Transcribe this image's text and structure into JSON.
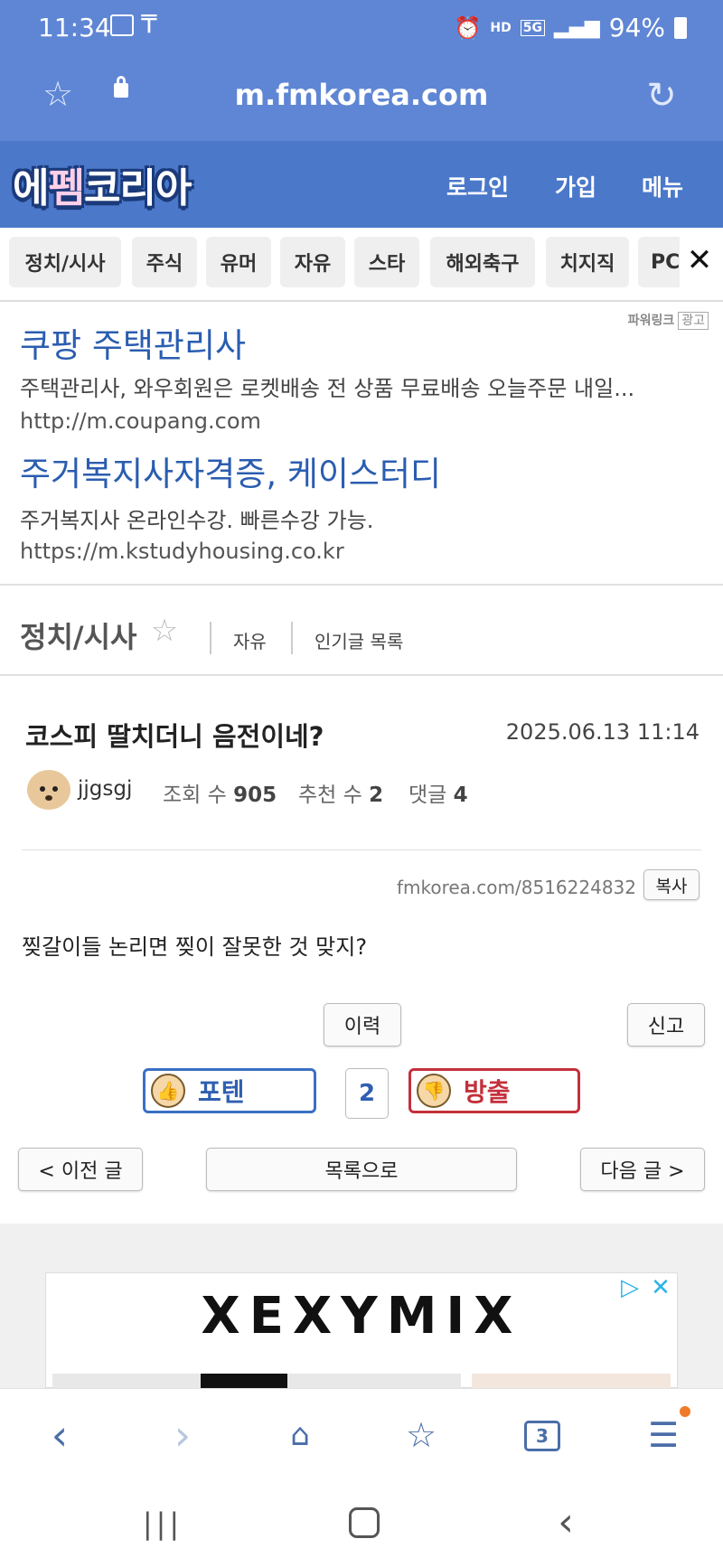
{
  "status_bar": {
    "time": "11:34",
    "battery": "94%",
    "network": "5G",
    "hd_voice": "HD"
  },
  "browser": {
    "url": "m.fmkorea.com",
    "tab_count": "3"
  },
  "site": {
    "logo_part1": "에",
    "logo_part2": "펨",
    "logo_part3": "코리아",
    "login": "로그인",
    "join": "가입",
    "menu": "메뉴"
  },
  "categories": [
    "정치/시사",
    "주식",
    "유머",
    "자유",
    "스타",
    "해외축구",
    "치지직",
    "PC"
  ],
  "ads": {
    "badge_label": "파워링크",
    "badge_tag": "광고",
    "items": [
      {
        "title": "쿠팡 주택관리사",
        "desc": "주택관리사, 와우회원은 로켓배송 전 상품 무료배송 오늘주문 내일...",
        "url": "http://m.coupang.com"
      },
      {
        "title": "주거복지사자격증, 케이스터디",
        "desc": "주거복지사 온라인수강. 빠른수강 가능.",
        "url": "https://m.kstudyhousing.co.kr"
      }
    ]
  },
  "board": {
    "title": "정치/시사",
    "link1": "자유",
    "link2": "인기글 목록"
  },
  "post": {
    "title": "코스피 딸치더니 음전이네?",
    "date": "2025.06.13 11:14",
    "author": "jjgsgj",
    "views_label": "조회 수",
    "views": "905",
    "recommend_label": "추천 수",
    "recommend": "2",
    "comments_label": "댓글",
    "comments": "4",
    "short_url": "fmkorea.com/8516224832",
    "copy_label": "복사",
    "body": "찢갈이들 논리면 찢이 잘못한 것 맞지?",
    "history_label": "이력",
    "report_label": "신고",
    "upvote_label": "포텐",
    "downvote_label": "방출",
    "vote_count": "2",
    "prev_label": "< 이전 글",
    "list_label": "목록으로",
    "next_label": "다음 글 >"
  },
  "banner_ad": {
    "brand": "XEXYMIX"
  },
  "colors": {
    "header": "#4b78c9",
    "address_bar": "#5f86d4",
    "link": "#2a5db0",
    "upvote": "#3b6fc4",
    "downvote": "#c4303b"
  }
}
